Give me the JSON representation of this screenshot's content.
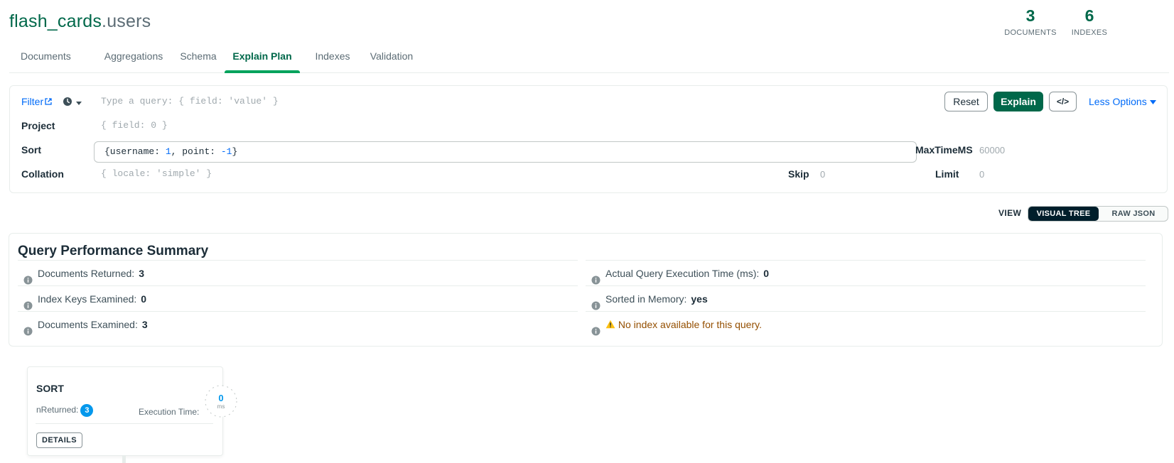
{
  "header": {
    "db_name": "flash_cards",
    "collection_name": ".users",
    "documents": {
      "count": "3",
      "label": "DOCUMENTS"
    },
    "indexes": {
      "count": "6",
      "label": "INDEXES"
    }
  },
  "tabs": [
    {
      "label": "Documents"
    },
    {
      "label": "Aggregations"
    },
    {
      "label": "Schema"
    },
    {
      "label": "Explain Plan",
      "active": true
    },
    {
      "label": "Indexes"
    },
    {
      "label": "Validation"
    }
  ],
  "query_bar": {
    "filter_label": "Filter",
    "filter_placeholder": "Type a query: { field: 'value' }",
    "project_label": "Project",
    "project_placeholder": "{ field: 0 }",
    "sort_label": "Sort",
    "sort_value": {
      "open": "{username: ",
      "n1": "1",
      "mid": ", point: ",
      "n2": "-1",
      "close": "}"
    },
    "collation_label": "Collation",
    "collation_placeholder": "{ locale: 'simple' }",
    "maxtime_label": "MaxTimeMS",
    "maxtime_value": "60000",
    "skip_label": "Skip",
    "skip_value": "0",
    "limit_label": "Limit",
    "limit_value": "0",
    "reset_label": "Reset",
    "explain_label": "Explain",
    "code_label": "</>",
    "less_options_label": "Less Options"
  },
  "view": {
    "label": "VIEW",
    "visual_tree": "VISUAL TREE",
    "raw_json": "RAW JSON",
    "selected": "VISUAL TREE"
  },
  "summary": {
    "title": "Query Performance Summary",
    "left": [
      {
        "label": "Documents Returned:",
        "value": "3"
      },
      {
        "label": "Index Keys Examined:",
        "value": "0"
      },
      {
        "label": "Documents Examined:",
        "value": "3"
      }
    ],
    "right": [
      {
        "label": "Actual Query Execution Time (ms):",
        "value": "0"
      },
      {
        "label": "Sorted in Memory:",
        "value": "yes"
      },
      {
        "label": "No index available for this query.",
        "value": ""
      }
    ]
  },
  "stage": {
    "name": "SORT",
    "nreturned_label": "nReturned:",
    "nreturned_value": "3",
    "exec_label": "Execution Time:",
    "exec_value": "0",
    "exec_unit": "ms",
    "details_label": "DETAILS"
  },
  "colors": {
    "brand_green": "#00684a",
    "accent_green": "#00a35c",
    "link_blue": "#016bf8",
    "warning": "#944f01",
    "badge_blue": "#0498ec"
  }
}
